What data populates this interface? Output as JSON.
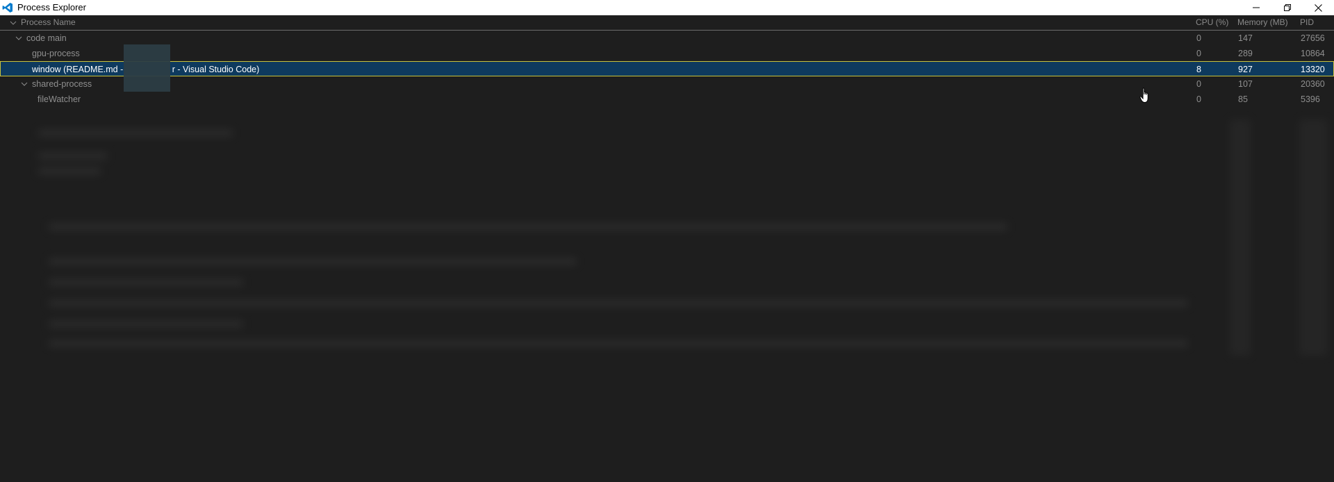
{
  "window": {
    "title": "Process Explorer",
    "icon": "vscode-icon",
    "controls": [
      "minimize-icon",
      "restore-icon",
      "close-icon"
    ]
  },
  "columns": {
    "name": "Process Name",
    "cpu": "CPU (%)",
    "memory": "Memory (MB)",
    "pid": "PID"
  },
  "rows": [
    {
      "name": "code main",
      "cpu": "0",
      "memory": "147",
      "pid": "27656",
      "expanded": true,
      "selected": false
    },
    {
      "name": "gpu-process",
      "cpu": "0",
      "memory": "289",
      "pid": "10864",
      "expanded": false,
      "selected": false
    },
    {
      "name": "window (README.md - ",
      "name_suffix": "r - Visual Studio Code)",
      "cpu": "8",
      "memory": "927",
      "pid": "13320",
      "expanded": false,
      "selected": true
    },
    {
      "name": "shared-process",
      "cpu": "0",
      "memory": "107",
      "pid": "20360",
      "expanded": true,
      "selected": false
    },
    {
      "name": "fileWatcher",
      "cpu": "0",
      "memory": "85",
      "pid": "5396",
      "expanded": false,
      "selected": false
    }
  ],
  "colors": {
    "background": "#1e1e1e",
    "selection_bg": "#0e3a5e",
    "selection_border": "#c9c23b",
    "text": "#8f8f8f",
    "accent_icon": "#007acc"
  }
}
